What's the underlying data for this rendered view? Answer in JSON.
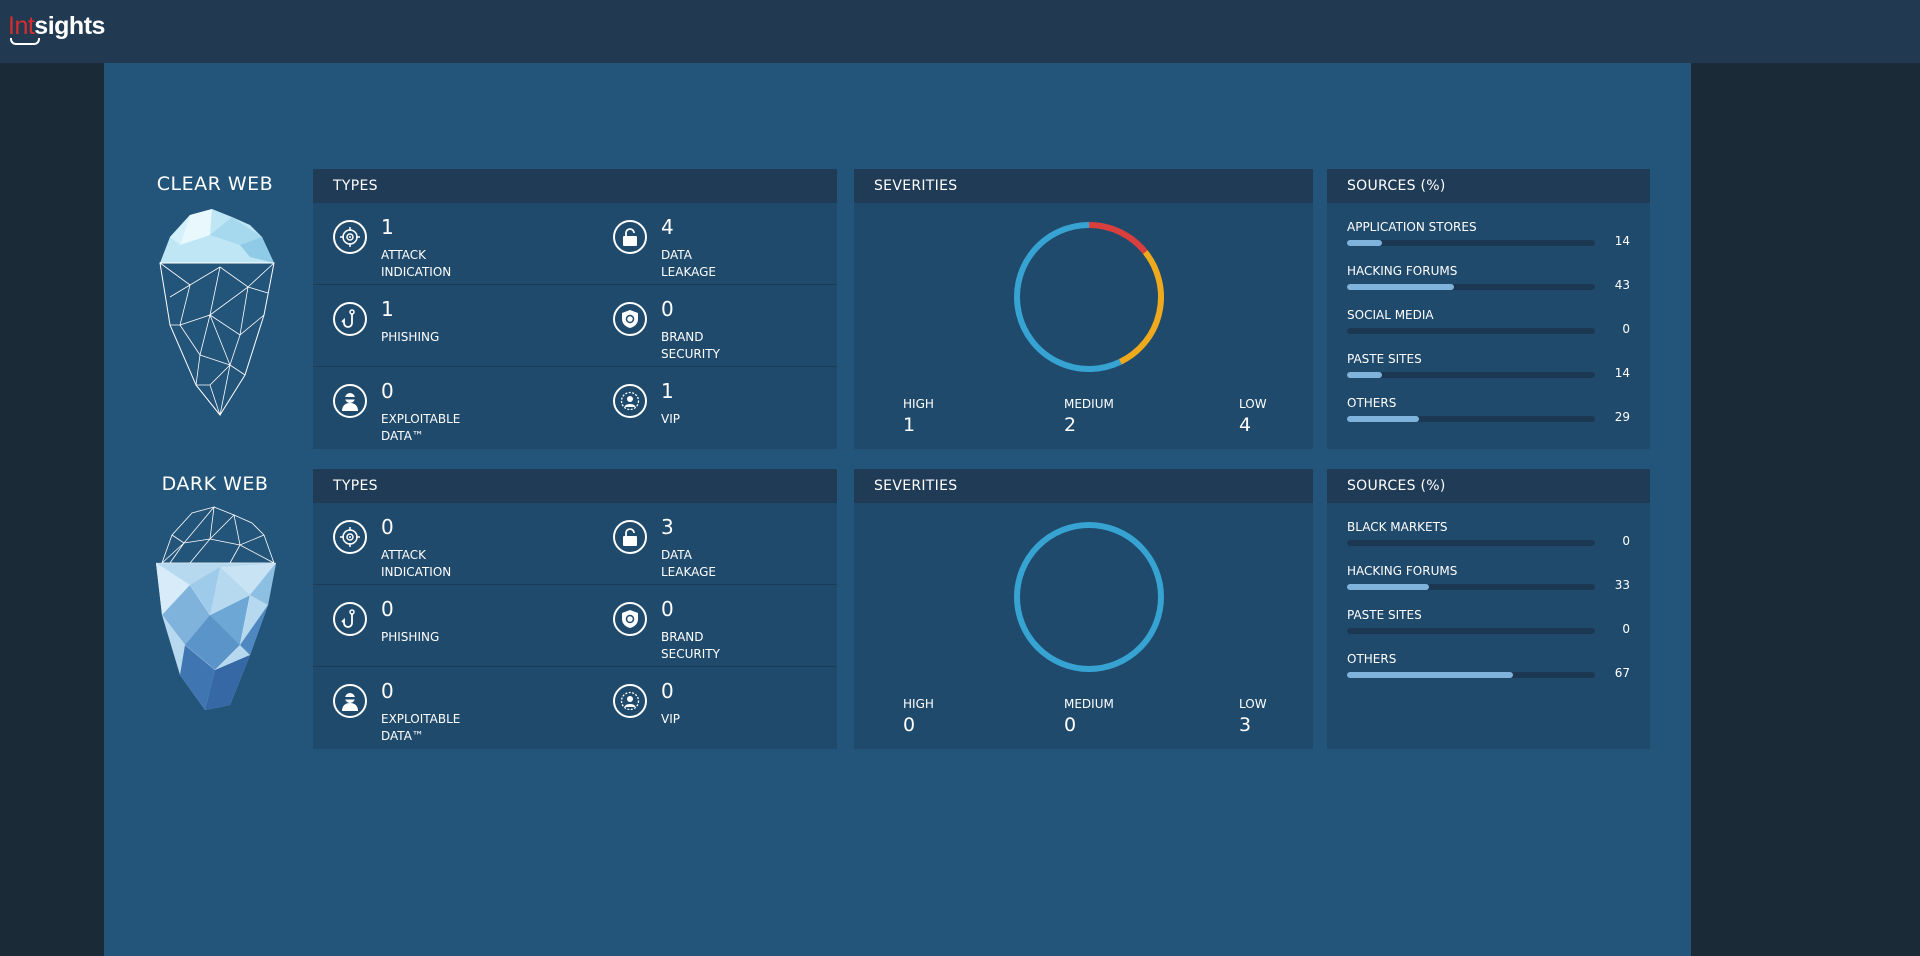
{
  "logo": {
    "part1": "Int",
    "part2": "sights"
  },
  "colors": {
    "high": "#d9403d",
    "medium": "#eea91d",
    "low": "#36a3d2",
    "accent": "#235479"
  },
  "rows": [
    {
      "title": "CLEAR WEB",
      "types": {
        "header": "TYPES",
        "items": [
          {
            "icon": "target-icon",
            "count": "1",
            "label1": "ATTACK",
            "label2": "INDICATION"
          },
          {
            "icon": "unlocked-padlock-icon",
            "count": "4",
            "label1": "DATA",
            "label2": "LEAKAGE"
          },
          {
            "icon": "fishing-hook-icon",
            "count": "1",
            "label1": "PHISHING",
            "label2": ""
          },
          {
            "icon": "shield-icon",
            "count": "0",
            "label1": "BRAND",
            "label2": "SECURITY"
          },
          {
            "icon": "hacker-icon",
            "count": "0",
            "label1": "EXPLOITABLE",
            "label2": "DATA™"
          },
          {
            "icon": "vip-person-icon",
            "count": "1",
            "label1": "VIP",
            "label2": ""
          }
        ]
      },
      "severities": {
        "header": "SEVERITIES",
        "high_label": "HIGH",
        "high": "1",
        "medium_label": "MEDIUM",
        "medium": "2",
        "low_label": "LOW",
        "low": "4"
      },
      "sources": {
        "header": "SOURCES (%)",
        "items": [
          {
            "name": "APPLICATION STORES",
            "value": "14"
          },
          {
            "name": "HACKING FORUMS",
            "value": "43"
          },
          {
            "name": "SOCIAL MEDIA",
            "value": "0"
          },
          {
            "name": "PASTE SITES",
            "value": "14"
          },
          {
            "name": "OTHERS",
            "value": "29"
          }
        ]
      }
    },
    {
      "title": "DARK WEB",
      "types": {
        "header": "TYPES",
        "items": [
          {
            "icon": "target-icon",
            "count": "0",
            "label1": "ATTACK",
            "label2": "INDICATION"
          },
          {
            "icon": "unlocked-padlock-icon",
            "count": "3",
            "label1": "DATA",
            "label2": "LEAKAGE"
          },
          {
            "icon": "fishing-hook-icon",
            "count": "0",
            "label1": "PHISHING",
            "label2": ""
          },
          {
            "icon": "shield-icon",
            "count": "0",
            "label1": "BRAND",
            "label2": "SECURITY"
          },
          {
            "icon": "hacker-icon",
            "count": "0",
            "label1": "EXPLOITABLE",
            "label2": "DATA™"
          },
          {
            "icon": "vip-person-icon",
            "count": "0",
            "label1": "VIP",
            "label2": ""
          }
        ]
      },
      "severities": {
        "header": "SEVERITIES",
        "high_label": "HIGH",
        "high": "0",
        "medium_label": "MEDIUM",
        "medium": "0",
        "low_label": "LOW",
        "low": "3"
      },
      "sources": {
        "header": "SOURCES (%)",
        "items": [
          {
            "name": "BLACK MARKETS",
            "value": "0"
          },
          {
            "name": "HACKING FORUMS",
            "value": "33"
          },
          {
            "name": "PASTE SITES",
            "value": "0"
          },
          {
            "name": "OTHERS",
            "value": "67"
          }
        ]
      }
    }
  ]
}
